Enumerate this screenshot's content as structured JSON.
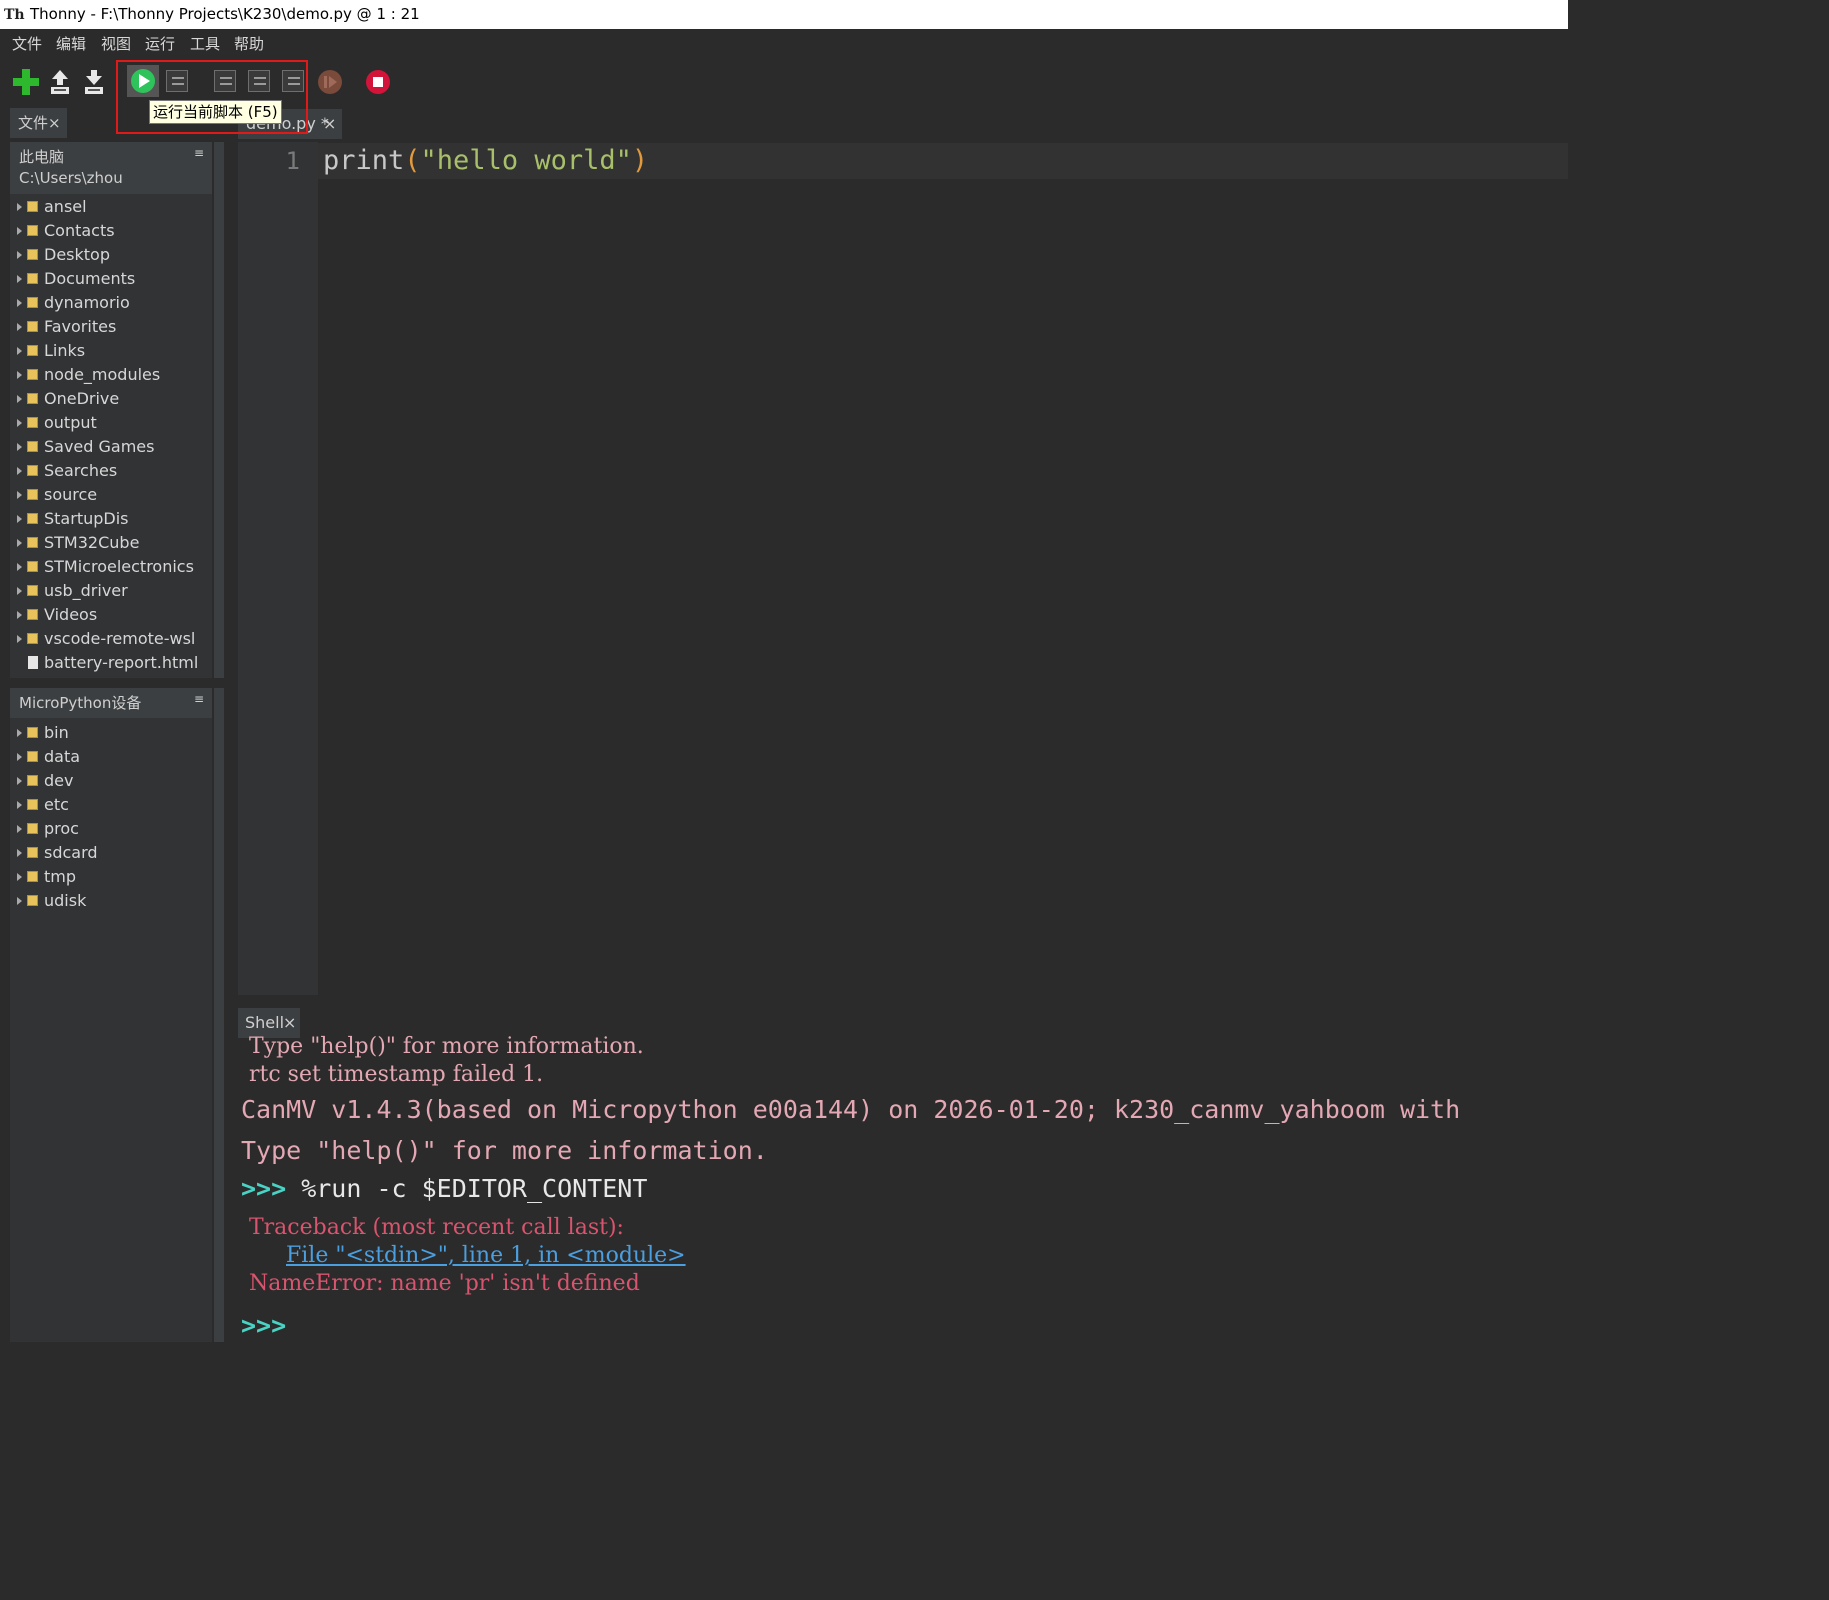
{
  "window": {
    "title": "Thonny  -  F:\\Thonny Projects\\K230\\demo.py  @  1 : 21",
    "app_icon_text": "Th"
  },
  "menu": [
    "文件",
    "编辑",
    "视图",
    "运行",
    "工具",
    "帮助"
  ],
  "toolbar": {
    "tooltip": "运行当前脚本 (F5)",
    "buttons": [
      "new-file",
      "load-file",
      "save-file",
      "run-current-script",
      "debug-current-script",
      "step-over",
      "step-into",
      "step-out",
      "resume",
      "stop"
    ]
  },
  "files_panel": {
    "tab_label": "文件",
    "close_glyph": "×",
    "menu_glyph": "≡",
    "this_pc": {
      "title": "此电脑",
      "path": "C:\\Users\\zhou",
      "items": [
        {
          "label": "ansel",
          "type": "folder"
        },
        {
          "label": "Contacts",
          "type": "folder"
        },
        {
          "label": "Desktop",
          "type": "folder"
        },
        {
          "label": "Documents",
          "type": "folder"
        },
        {
          "label": "dynamorio",
          "type": "folder"
        },
        {
          "label": "Favorites",
          "type": "folder"
        },
        {
          "label": "Links",
          "type": "folder"
        },
        {
          "label": "node_modules",
          "type": "folder"
        },
        {
          "label": "OneDrive",
          "type": "folder"
        },
        {
          "label": "output",
          "type": "folder"
        },
        {
          "label": "Saved Games",
          "type": "folder"
        },
        {
          "label": "Searches",
          "type": "folder"
        },
        {
          "label": "source",
          "type": "folder"
        },
        {
          "label": "StartupDis",
          "type": "folder"
        },
        {
          "label": "STM32Cube",
          "type": "folder"
        },
        {
          "label": "STMicroelectronics",
          "type": "folder"
        },
        {
          "label": "usb_driver",
          "type": "folder"
        },
        {
          "label": "Videos",
          "type": "folder"
        },
        {
          "label": "vscode-remote-wsl",
          "type": "folder"
        },
        {
          "label": "battery-report.html",
          "type": "file"
        }
      ]
    },
    "device": {
      "title": "MicroPython设备",
      "items": [
        {
          "label": "bin",
          "type": "folder"
        },
        {
          "label": "data",
          "type": "folder"
        },
        {
          "label": "dev",
          "type": "folder"
        },
        {
          "label": "etc",
          "type": "folder"
        },
        {
          "label": "proc",
          "type": "folder"
        },
        {
          "label": "sdcard",
          "type": "folder"
        },
        {
          "label": "tmp",
          "type": "folder"
        },
        {
          "label": "udisk",
          "type": "folder"
        }
      ]
    }
  },
  "editor": {
    "tab_label": "demo.py *",
    "close_glyph": "×",
    "line_number": "1",
    "code": {
      "func": "print",
      "open": "(",
      "string": "\"hello world\"",
      "close": ")"
    }
  },
  "shell": {
    "tab_label": "Shell",
    "close_glyph": "×",
    "lines": {
      "l1": " Type \"help()\" for more information.",
      "l2": " rtc set timestamp failed 1.",
      "l3": "CanMV v1.4.3(based on Micropython e00a144) on 2026-01-20; k230_canmv_yahboom with",
      "l4": "Type \"help()\" for more information.",
      "prompt": ">>>",
      "command": " %run -c $EDITOR_CONTENT",
      "tb1": " Traceback (most recent call last):",
      "tb2": "File \"<stdin>\", line 1, in <module>",
      "tb3": " NameError: name 'pr' isn't defined",
      "prompt2": ">>>"
    }
  },
  "colors": {
    "background": "#2b2b2b",
    "run_green": "#2ec35b",
    "stop_red": "#d2143a",
    "error_text": "#d9546e",
    "prompt": "#49d3c4",
    "string_green": "#a8c06a",
    "paren_orange": "#e39a3c",
    "highlight_box": "#e01919"
  }
}
